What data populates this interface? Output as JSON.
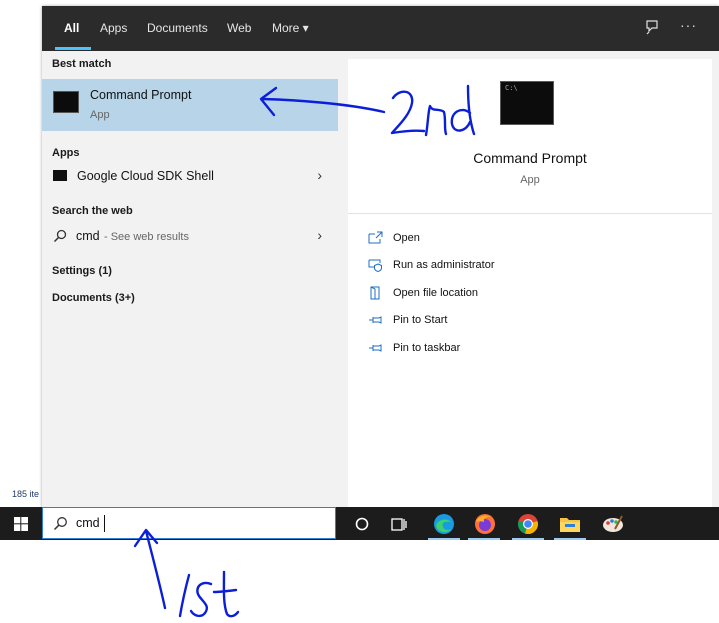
{
  "background": {
    "status_text": "185 ite"
  },
  "tabs": [
    {
      "label": "All",
      "active": true
    },
    {
      "label": "Apps"
    },
    {
      "label": "Documents"
    },
    {
      "label": "Web"
    },
    {
      "label": "More ▾"
    }
  ],
  "topbar_icons": [
    "feedback-icon",
    "more-options-icon"
  ],
  "results": {
    "best_match_header": "Best match",
    "best_match": {
      "title": "Command Prompt",
      "subtitle": "App"
    },
    "apps_header": "Apps",
    "apps": [
      {
        "label": "Google Cloud SDK Shell"
      }
    ],
    "web_header": "Search the web",
    "web": {
      "query": "cmd",
      "suffix": " - See web results"
    },
    "settings": "Settings (1)",
    "documents": "Documents (3+)"
  },
  "details": {
    "title": "Command Prompt",
    "subtitle": "App",
    "actions": [
      {
        "label": "Open",
        "icon": "open-icon"
      },
      {
        "label": "Run as administrator",
        "icon": "shield-icon"
      },
      {
        "label": "Open file location",
        "icon": "folder-location-icon"
      },
      {
        "label": "Pin to Start",
        "icon": "pin-icon"
      },
      {
        "label": "Pin to taskbar",
        "icon": "pin-icon"
      }
    ]
  },
  "taskbar": {
    "search_value": "cmd",
    "icons": [
      "cortana-icon",
      "task-view-icon",
      "edge-icon",
      "firefox-icon",
      "chrome-icon",
      "file-explorer-icon",
      "paint-icon"
    ]
  },
  "annotations": {
    "first": "1st",
    "second": "2nd"
  },
  "colors": {
    "accent": "#4cc2ff",
    "selection": "#b7d4e8",
    "topbar": "#2b2b2b",
    "taskbar": "#1c1c1c",
    "ink": "#0b1fd8"
  }
}
